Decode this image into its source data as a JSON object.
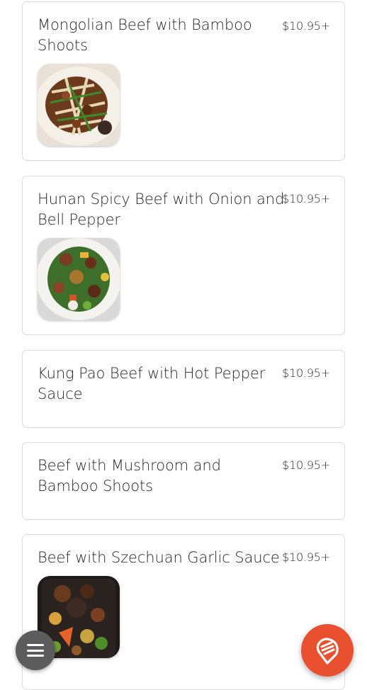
{
  "menu_items": [
    {
      "name": "Mongolian Beef with Bamboo Shoots",
      "price": "$10.95+",
      "image": "mongolian-beef-photo"
    },
    {
      "name": "Hunan Spicy Beef with Onion and Bell Pepper",
      "price": "$10.95+",
      "image": "hunan-beef-photo"
    },
    {
      "name": "Kung Pao Beef with Hot Pepper Sauce",
      "price": "$10.95+"
    },
    {
      "name": "Beef with Mushroom and Bamboo Shoots",
      "price": "$10.95+"
    },
    {
      "name": "Beef with Szechuan Garlic Sauce",
      "price": "$10.95+",
      "image": "szechuan-beef-photo"
    }
  ],
  "fab": {
    "menu_icon": "hamburger-menu-icon",
    "order_icon": "food-order-icon"
  },
  "colors": {
    "order_button": "#e8502f",
    "menu_button": "#5c5c5c",
    "card_border": "#dcdcdc"
  }
}
